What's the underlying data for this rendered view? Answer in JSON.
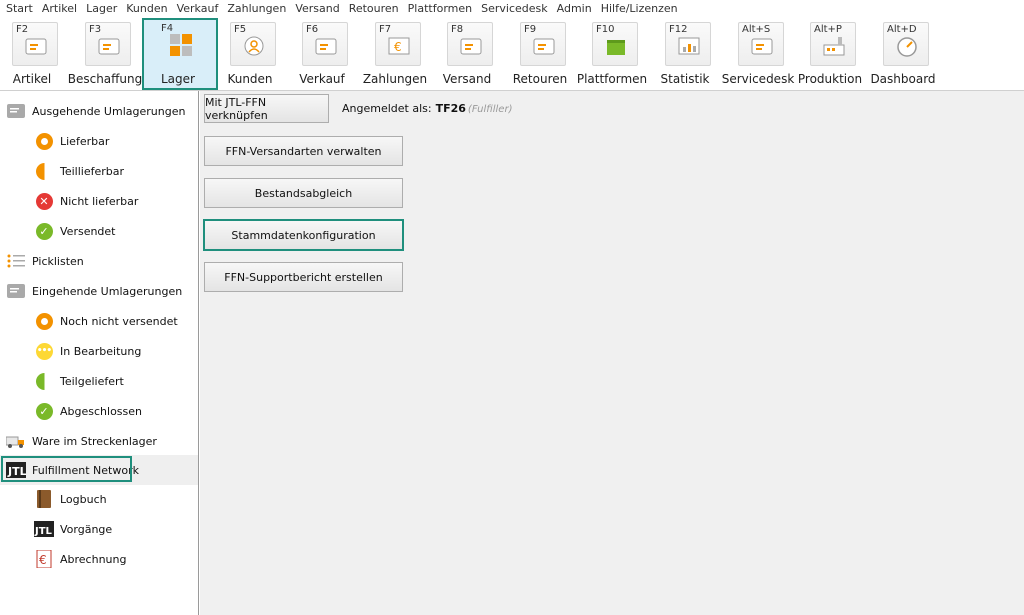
{
  "menu": [
    "Start",
    "Artikel",
    "Lager",
    "Kunden",
    "Verkauf",
    "Zahlungen",
    "Versand",
    "Retouren",
    "Plattformen",
    "Servicedesk",
    "Admin",
    "Hilfe/Lizenzen"
  ],
  "ribbon": [
    {
      "key": "F2",
      "label": "Artikel",
      "icon": "tag-icon"
    },
    {
      "key": "F3",
      "label": "Beschaffung",
      "icon": "box-download-icon"
    },
    {
      "key": "F4",
      "label": "Lager",
      "icon": "warehouse-icon"
    },
    {
      "key": "F5",
      "label": "Kunden",
      "icon": "customer-icon"
    },
    {
      "key": "F6",
      "label": "Verkauf",
      "icon": "shopping-bag-icon"
    },
    {
      "key": "F7",
      "label": "Zahlungen",
      "icon": "euro-icon"
    },
    {
      "key": "F8",
      "label": "Versand",
      "icon": "shipping-icon"
    },
    {
      "key": "F9",
      "label": "Retouren",
      "icon": "return-icon"
    },
    {
      "key": "F10",
      "label": "Plattformen",
      "icon": "platform-icon"
    },
    {
      "key": "F12",
      "label": "Statistik",
      "icon": "statistics-icon"
    },
    {
      "key": "Alt+S",
      "label": "Servicedesk",
      "icon": "servicedesk-icon"
    },
    {
      "key": "Alt+P",
      "label": "Produktion",
      "icon": "factory-icon"
    },
    {
      "key": "Alt+D",
      "label": "Dashboard",
      "icon": "gauge-icon"
    }
  ],
  "sidebar": {
    "outgoing": "Ausgehende Umlagerungen",
    "lieferbar": "Lieferbar",
    "teillieferbar": "Teillieferbar",
    "nicht_lieferbar": "Nicht lieferbar",
    "versendet": "Versendet",
    "picklisten": "Picklisten",
    "incoming": "Eingehende Umlagerungen",
    "noch_nicht": "Noch nicht versendet",
    "in_bearbeitung": "In Bearbeitung",
    "teilgeliefert": "Teilgeliefert",
    "abgeschlossen": "Abgeschlossen",
    "streckenlager": "Ware im Streckenlager",
    "ffn": "Fulfillment Network",
    "logbuch": "Logbuch",
    "vorgaenge": "Vorgänge",
    "abrechnung": "Abrechnung"
  },
  "main": {
    "link_button": "Mit JTL-FFN verknüpfen",
    "logged_in_label": "Angemeldet als:",
    "user": "TF26",
    "role": "(Fulfiller)",
    "b1": "FFN-Versandarten verwalten",
    "b2": "Bestandsabgleich",
    "b3": "Stammdatenkonfiguration",
    "b4": "FFN-Supportbericht erstellen"
  },
  "colors": {
    "accent": "#1f8f7d",
    "orange": "#f39200",
    "green": "#7ab929",
    "red": "#e53935",
    "yellow": "#fdd835"
  }
}
